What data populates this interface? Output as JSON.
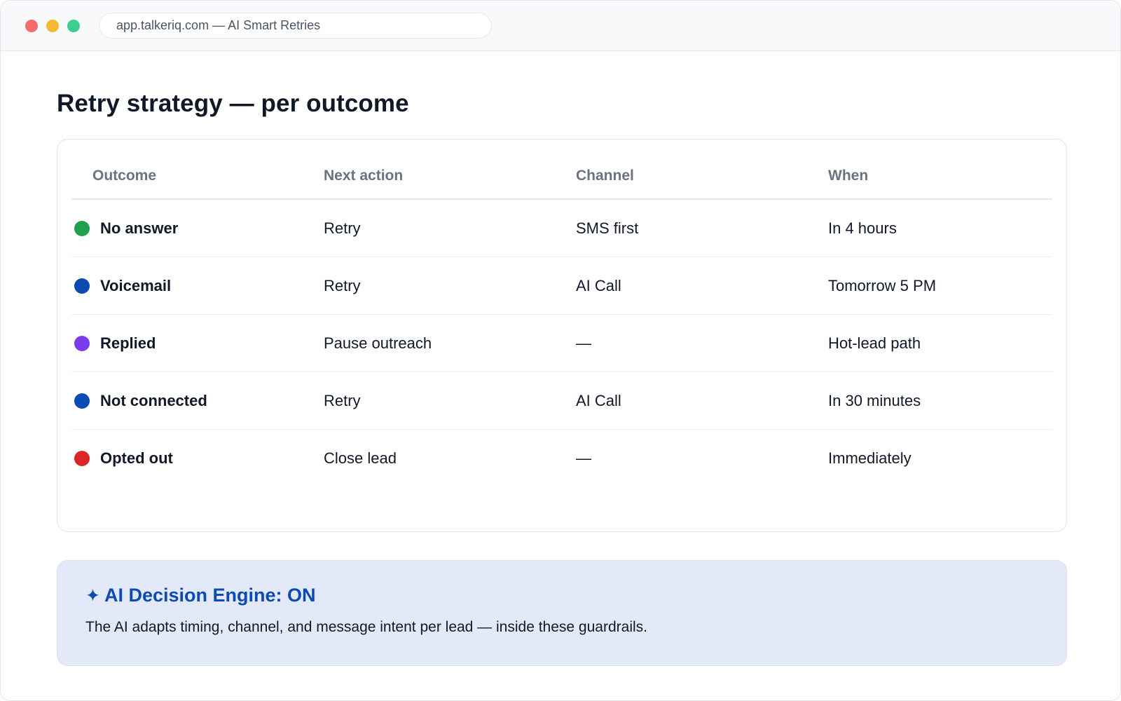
{
  "window": {
    "url_text": "app.talkeriq.com — AI Smart Retries"
  },
  "page": {
    "title": "Retry strategy — per outcome"
  },
  "table": {
    "headers": [
      "Outcome",
      "Next action",
      "Channel",
      "When"
    ],
    "rows": [
      {
        "outcome": "No answer",
        "action": "Retry",
        "channel": "SMS first",
        "when": "In 4 hours",
        "color": "#1fa04f"
      },
      {
        "outcome": "Voicemail",
        "action": "Retry",
        "channel": "AI Call",
        "when": "Tomorrow 5 PM",
        "color": "#0b4bb3"
      },
      {
        "outcome": "Replied",
        "action": "Pause outreach",
        "channel": "—",
        "when": "Hot-lead path",
        "color": "#7c3aed"
      },
      {
        "outcome": "Not connected",
        "action": "Retry",
        "channel": "AI Call",
        "when": "In 30 minutes",
        "color": "#0b4bb3"
      },
      {
        "outcome": "Opted out",
        "action": "Close lead",
        "channel": "—",
        "when": "Immediately",
        "color": "#dc2626"
      }
    ]
  },
  "banner": {
    "icon": "sparkle-icon",
    "icon_glyph": "✦",
    "title": "AI Decision Engine: ON",
    "text": "The AI adapts timing, channel, and message intent per lead — inside these guardrails.",
    "accent_color": "#0b4bb3"
  }
}
